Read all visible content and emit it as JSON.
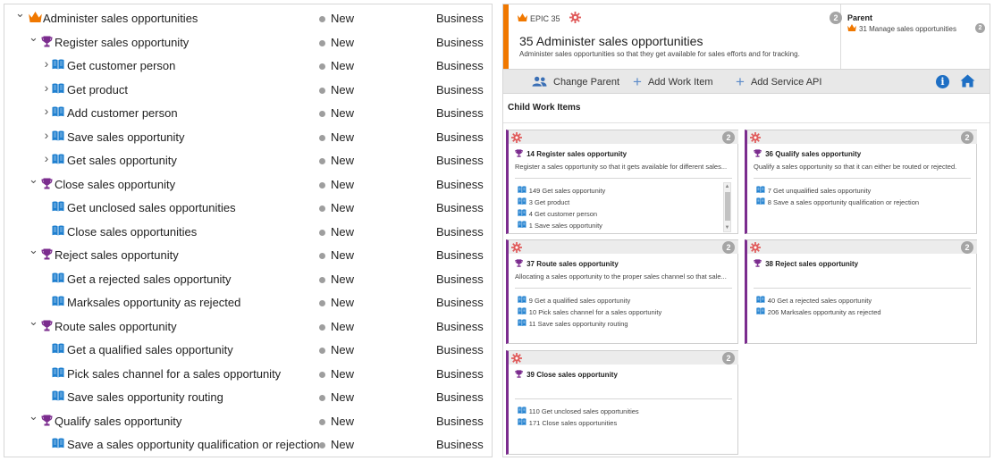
{
  "tree": {
    "rows": [
      {
        "title": "Administer sales opportunities",
        "state": "New",
        "area": "Business",
        "type": "epic",
        "level": 0,
        "chevron": "down"
      },
      {
        "title": "Register sales opportunity",
        "state": "New",
        "area": "Business",
        "type": "feature",
        "level": 1,
        "chevron": "down"
      },
      {
        "title": "Get customer person",
        "state": "New",
        "area": "Business",
        "type": "story",
        "level": 2,
        "chevron": "right"
      },
      {
        "title": "Get product",
        "state": "New",
        "area": "Business",
        "type": "story",
        "level": 2,
        "chevron": "right"
      },
      {
        "title": "Add customer person",
        "state": "New",
        "area": "Business",
        "type": "story",
        "level": 2,
        "chevron": "right"
      },
      {
        "title": "Save sales opportunity",
        "state": "New",
        "area": "Business",
        "type": "story",
        "level": 2,
        "chevron": "right"
      },
      {
        "title": "Get sales opportunity",
        "state": "New",
        "area": "Business",
        "type": "story",
        "level": 2,
        "chevron": "right"
      },
      {
        "title": "Close sales opportunity",
        "state": "New",
        "area": "Business",
        "type": "feature",
        "level": 1,
        "chevron": "down"
      },
      {
        "title": "Get unclosed sales opportunities",
        "state": "New",
        "area": "Business",
        "type": "story",
        "level": 2,
        "chevron": ""
      },
      {
        "title": "Close sales opportunities",
        "state": "New",
        "area": "Business",
        "type": "story",
        "level": 2,
        "chevron": ""
      },
      {
        "title": "Reject sales opportunity",
        "state": "New",
        "area": "Business",
        "type": "feature",
        "level": 1,
        "chevron": "down"
      },
      {
        "title": "Get a rejected sales opportunity",
        "state": "New",
        "area": "Business",
        "type": "story",
        "level": 2,
        "chevron": ""
      },
      {
        "title": "Marksales opportunity as rejected",
        "state": "New",
        "area": "Business",
        "type": "story",
        "level": 2,
        "chevron": ""
      },
      {
        "title": "Route sales opportunity",
        "state": "New",
        "area": "Business",
        "type": "feature",
        "level": 1,
        "chevron": "down"
      },
      {
        "title": "Get a qualified sales opportunity",
        "state": "New",
        "area": "Business",
        "type": "story",
        "level": 2,
        "chevron": ""
      },
      {
        "title": "Pick sales channel for a sales opportunity",
        "state": "New",
        "area": "Business",
        "type": "story",
        "level": 2,
        "chevron": ""
      },
      {
        "title": "Save sales opportunity routing",
        "state": "New",
        "area": "Business",
        "type": "story",
        "level": 2,
        "chevron": ""
      },
      {
        "title": "Qualify sales opportunity",
        "state": "New",
        "area": "Business",
        "type": "feature",
        "level": 1,
        "chevron": "down"
      },
      {
        "title": "Save a sales opportunity qualification or rejection",
        "state": "New",
        "area": "Business",
        "type": "story",
        "level": 2,
        "chevron": ""
      }
    ]
  },
  "epic": {
    "tag": "EPIC 35",
    "badge": "2",
    "title": "35  Administer sales opportunities",
    "description": "Administer sales opportunities so that they get available for sales efforts and for tracking."
  },
  "parent": {
    "label": "Parent",
    "item": "31  Manage sales opportunities",
    "badge": "2"
  },
  "toolbar": {
    "change_parent": "Change Parent",
    "add_work_item": "Add Work Item",
    "add_service_api": "Add Service API",
    "info_glyph": "i"
  },
  "child_section": {
    "heading": "Child Work Items"
  },
  "cards": [
    {
      "badge": "2",
      "title": "14  Register sales opportunity",
      "description": "Register a sales opportunity so that it gets available for different sales...",
      "items": [
        "149  Get sales opportunity",
        "3  Get product",
        "4  Get customer person",
        "1  Save sales opportunity"
      ],
      "scroll": true
    },
    {
      "badge": "2",
      "title": "36  Qualify sales opportunity",
      "description": "Qualify a sales opportunity so that it can either be routed or rejected.",
      "items": [
        "7  Get unqualified sales opportunity",
        "8  Save a sales opportunity qualification or rejection"
      ],
      "scroll": false
    },
    {
      "badge": "2",
      "title": "37  Route sales opportunity",
      "description": "Allocating a sales opportunity to the proper sales channel so that sale...",
      "items": [
        "9  Get a qualified sales opportunity",
        "10  Pick sales channel for a sales opportunity",
        "11  Save sales opportunity routing"
      ],
      "scroll": false
    },
    {
      "badge": "2",
      "title": "38  Reject sales opportunity",
      "description": "",
      "items": [
        "40  Get a rejected sales opportunity",
        "206  Marksales opportunity as rejected"
      ],
      "scroll": false
    },
    {
      "badge": "2",
      "title": "39  Close sales opportunity",
      "description": "",
      "items": [
        "110  Get unclosed sales opportunities",
        "171  Close sales opportunities"
      ],
      "scroll": false
    }
  ],
  "icons": {
    "epic": "crown-icon",
    "feature": "trophy-icon",
    "story": "book-icon",
    "gear": "gear-icon",
    "people": "people-icon",
    "plus": "plus-icon",
    "info": "info-icon",
    "home": "home-icon"
  },
  "colors": {
    "epic_orange": "#f07800",
    "feature_purple": "#7b2c8e",
    "story_blue": "#1e7fcf",
    "accent_blue": "#1e6fc4",
    "gear_red": "#e05a5a",
    "state_gray": "#9e9e9e"
  }
}
